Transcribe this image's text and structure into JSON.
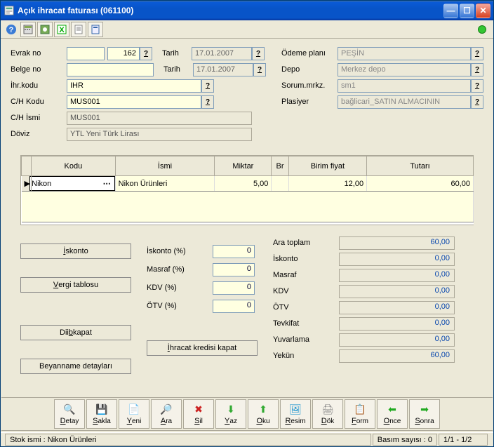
{
  "window": {
    "title": "Açık ihracat faturası (061100)"
  },
  "toolbar_icons": [
    "help",
    "calc",
    "cfg",
    "xls",
    "doc",
    "page"
  ],
  "header": {
    "evrak_no_label": "Evrak no",
    "evrak_no_val": "162",
    "belge_no_label": "Belge no",
    "belge_no_val": "",
    "ihr_kodu_label": "İhr.kodu",
    "ihr_kodu_val": "IHR",
    "ch_kodu_label": "C/H Kodu",
    "ch_kodu_val": "MUS001",
    "ch_ismi_label": "C/H İsmi",
    "ch_ismi_val": "MUS001",
    "doviz_label": "Döviz",
    "doviz_val": "YTL Yeni Türk Lirası",
    "tarih1_label": "Tarih",
    "tarih1_val": "17.01.2007",
    "tarih2_label": "Tarih",
    "tarih2_val": "17.01.2007",
    "odeme_label": "Ödeme planı",
    "odeme_val": "PEŞİN",
    "depo_label": "Depo",
    "depo_val": "Merkez depo",
    "sorum_label": "Sorum.mrkz.",
    "sorum_val": "sm1",
    "plasiyer_label": "Plasiyer",
    "plasiyer_val": "bağlicari_SATIN ALMACININ"
  },
  "grid": {
    "cols": {
      "kodu": "Kodu",
      "ismi": "İsmi",
      "miktar": "Miktar",
      "br": "Br",
      "birim_fiyat": "Birim fiyat",
      "tutari": "Tutarı"
    },
    "row": {
      "kodu": "Nikon",
      "ismi": "Nikon Ürünleri",
      "miktar": "5,00",
      "br": "",
      "birim_fiyat": "12,00",
      "tutari": "60,00"
    }
  },
  "buttons": {
    "iskonto": "İskonto",
    "vergi_tablosu": "Vergi tablosu",
    "diib_kapat": "Diib kapat",
    "ihracat_kredisi_kapat": "İhracat kredisi kapat",
    "beyanname": "Beyanname detayları"
  },
  "percents": {
    "iskonto_l": "İskonto (%)",
    "iskonto_v": "0",
    "masraf_l": "Masraf (%)",
    "masraf_v": "0",
    "kdv_l": "KDV    (%)",
    "kdv_v": "0",
    "otv_l": "ÖTV    (%)",
    "otv_v": "0"
  },
  "totals": {
    "ara_toplam_l": "Ara toplam",
    "ara_toplam_v": "60,00",
    "iskonto_l": "İskonto",
    "iskonto_v": "0,00",
    "masraf_l": "Masraf",
    "masraf_v": "0,00",
    "kdv_l": "KDV",
    "kdv_v": "0,00",
    "otv_l": "ÖTV",
    "otv_v": "0,00",
    "tevkifat_l": "Tevkifat",
    "tevkifat_v": "0,00",
    "yuvarlama_l": "Yuvarlama",
    "yuvarlama_v": "0,00",
    "yekun_l": "Yekün",
    "yekun_v": "60,00"
  },
  "bottombar": [
    {
      "key": "D",
      "label": "Detay",
      "icon": "🔍",
      "color": "#6aa"
    },
    {
      "key": "S",
      "label": "Sakla",
      "icon": "💾",
      "color": "#36a"
    },
    {
      "key": "Y",
      "label": "Yeni",
      "icon": "📄",
      "color": "#e90"
    },
    {
      "key": "A",
      "label": "Ara",
      "icon": "🔎",
      "color": "#57c"
    },
    {
      "key": "S",
      "label": "Sil",
      "icon": "✖",
      "color": "#c22"
    },
    {
      "key": "Y",
      "label": "Yaz",
      "icon": "⬇",
      "color": "#3a3"
    },
    {
      "key": "O",
      "label": "Oku",
      "icon": "⬆",
      "color": "#3a3"
    },
    {
      "key": "R",
      "label": "Resim",
      "icon": "🖼",
      "color": "#08c"
    },
    {
      "key": "D",
      "label": "Dök",
      "icon": "🖨",
      "color": "#888"
    },
    {
      "key": "F",
      "label": "Form",
      "icon": "📋",
      "color": "#9a6"
    },
    {
      "key": "O",
      "label": "Önce",
      "icon": "⬅",
      "color": "#2a2"
    },
    {
      "key": "S",
      "label": "Sonra",
      "icon": "➡",
      "color": "#2a2"
    }
  ],
  "status": {
    "left": "Stok ismi : Nikon Ürünleri",
    "mid": "Basım sayısı : 0",
    "right": "1/1 - 1/2"
  }
}
